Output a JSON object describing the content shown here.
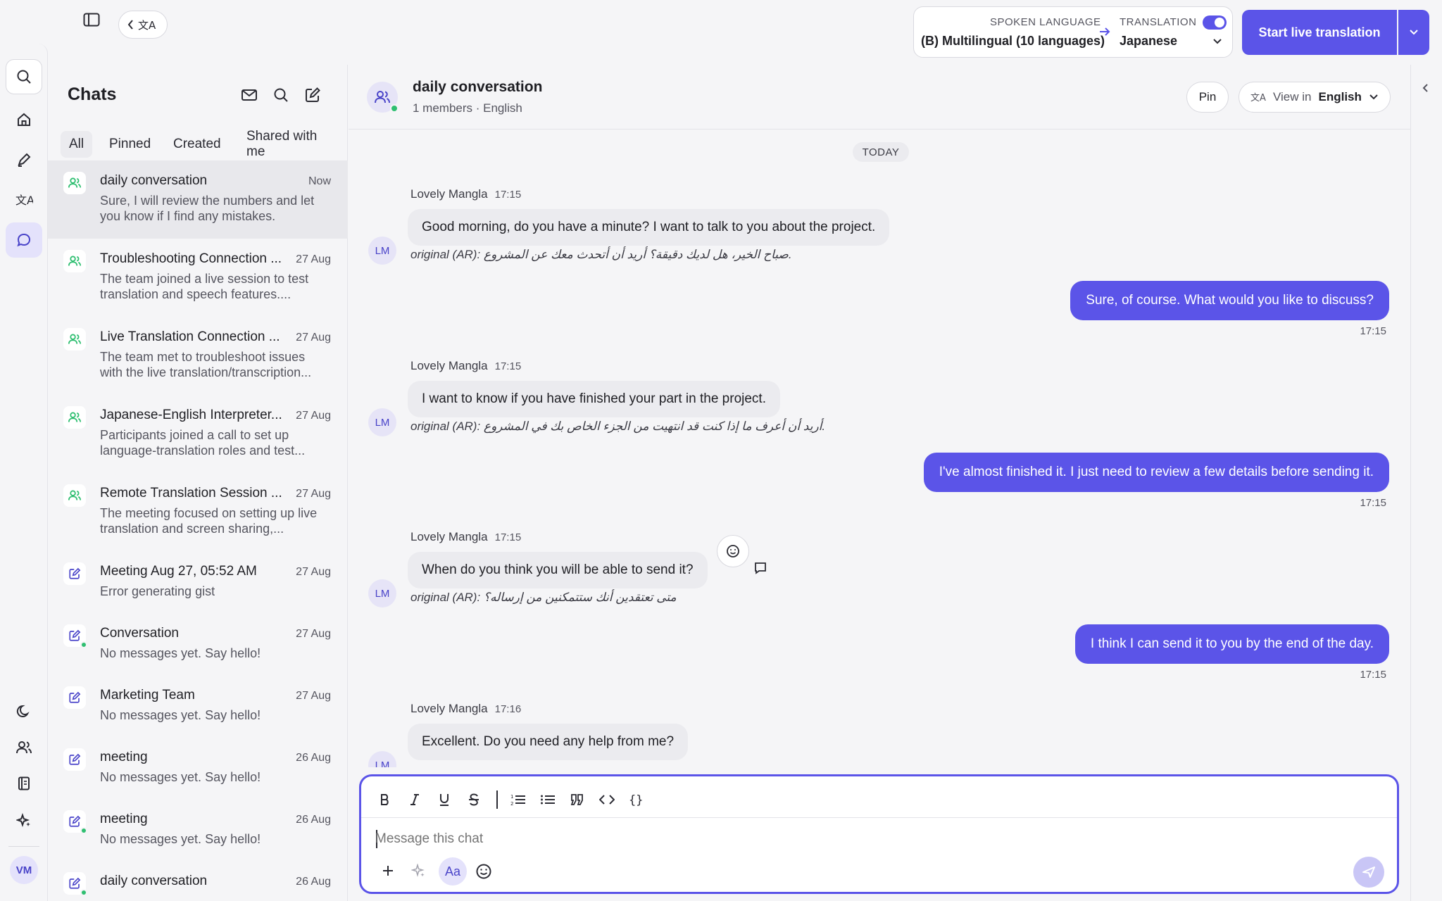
{
  "topbar": {
    "spoken_language_caption": "SPOKEN LANGUAGE",
    "spoken_language_value": "(B) Multilingual (10 languages)",
    "translation_caption": "TRANSLATION",
    "translation_value": "Japanese",
    "live_button": "Start live translation"
  },
  "chats": {
    "title": "Chats",
    "tabs": [
      "All",
      "Pinned",
      "Created",
      "Shared with me"
    ],
    "items": [
      {
        "name": "daily conversation",
        "time": "Now",
        "preview": "Sure, I will review the numbers and let you know if I find any mistakes."
      },
      {
        "name": "Troubleshooting Connection ...",
        "time": "27 Aug",
        "preview": "The team joined a live session to test translation and speech features...."
      },
      {
        "name": "Live Translation Connection ...",
        "time": "27 Aug",
        "preview": "The team met to troubleshoot issues with the live translation/transcription..."
      },
      {
        "name": "Japanese-English Interpreter...",
        "time": "27 Aug",
        "preview": "Participants joined a call to set up language-translation roles and test..."
      },
      {
        "name": "Remote Translation Session ...",
        "time": "27 Aug",
        "preview": "The meeting focused on setting up live translation and screen sharing,..."
      },
      {
        "name": "Meeting Aug 27, 05:52 AM",
        "time": "27 Aug",
        "preview": "Error generating gist"
      },
      {
        "name": "Conversation",
        "time": "27 Aug",
        "preview": "No messages yet. Say hello!"
      },
      {
        "name": "Marketing Team",
        "time": "27 Aug",
        "preview": "No messages yet. Say hello!"
      },
      {
        "name": "meeting",
        "time": "26 Aug",
        "preview": "No messages yet. Say hello!"
      },
      {
        "name": "meeting",
        "time": "26 Aug",
        "preview": "No messages yet. Say hello!"
      },
      {
        "name": "daily conversation",
        "time": "26 Aug",
        "preview": ""
      }
    ]
  },
  "conversation": {
    "title": "daily conversation",
    "subtitle": "1 members · English",
    "pin_label": "Pin",
    "view_in_label": "View in",
    "view_in_value": "English",
    "day_divider": "TODAY",
    "messages": [
      {
        "sender": "Lovely Mangla",
        "time": "17:15",
        "text": "Good morning, do you have a minute? I want to talk to you about the project.",
        "original": "original (AR): صباح الخير، هل لديك دقيقة؟ أريد أن أتحدث معك عن المشروع."
      },
      {
        "out": true,
        "text": "Sure, of course. What would you like to discuss?",
        "time": "17:15"
      },
      {
        "sender": "Lovely Mangla",
        "time": "17:15",
        "text": "I want to know if you have finished your part in the project.",
        "original": "original (AR): أريد أن أعرف ما إذا كنت قد انتهيت من الجزء الخاص بك في المشروع."
      },
      {
        "out": true,
        "text": "I've almost finished it. I just need to review a few details before sending it.",
        "time": "17:15"
      },
      {
        "sender": "Lovely Mangla",
        "time": "17:15",
        "text": "When do you think you will be able to send it?",
        "original": "original (AR): متى تعتقدين أنك ستتمكنين من إرساله؟"
      },
      {
        "out": true,
        "text": "I think I can send it to you by the end of the day.",
        "time": "17:15"
      },
      {
        "sender": "Lovely Mangla",
        "time": "17:16",
        "text": "Excellent. Do you need any help from me?"
      }
    ],
    "avatar_initials": "LM"
  },
  "composer": {
    "placeholder": "Message this chat",
    "format_label": "Aa"
  },
  "user": {
    "initials": "VM"
  },
  "colors": {
    "accent": "#5b54e8",
    "online": "#2fbf71"
  }
}
